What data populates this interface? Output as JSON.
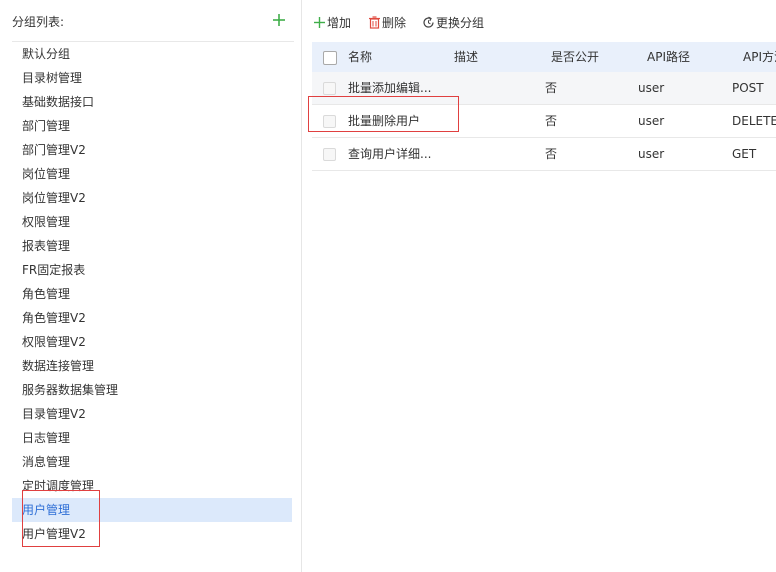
{
  "left_panel": {
    "title": "分组列表:",
    "add_icon": "plus-icon",
    "groups": [
      {
        "label": "默认分组"
      },
      {
        "label": "目录树管理"
      },
      {
        "label": "基础数据接口"
      },
      {
        "label": "部门管理"
      },
      {
        "label": "部门管理V2"
      },
      {
        "label": "岗位管理"
      },
      {
        "label": "岗位管理V2"
      },
      {
        "label": "权限管理"
      },
      {
        "label": "报表管理"
      },
      {
        "label": "FR固定报表"
      },
      {
        "label": "角色管理"
      },
      {
        "label": "角色管理V2"
      },
      {
        "label": "权限管理V2"
      },
      {
        "label": "数据连接管理"
      },
      {
        "label": "服务器数据集管理"
      },
      {
        "label": "目录管理V2"
      },
      {
        "label": "日志管理"
      },
      {
        "label": "消息管理"
      },
      {
        "label": "定时调度管理"
      },
      {
        "label": "用户管理"
      },
      {
        "label": "用户管理V2"
      }
    ],
    "selected_group": "用户管理"
  },
  "toolbar": {
    "add_label": "增加",
    "delete_label": "删除",
    "move_label": "更换分组",
    "add_icon": "plus-icon",
    "delete_icon": "trash-icon",
    "move_icon": "refresh-icon"
  },
  "table": {
    "columns": {
      "name": "名称",
      "desc": "描述",
      "public": "是否公开",
      "path": "API路径",
      "method": "API方法"
    },
    "rows": [
      {
        "name": "批量添加编辑...",
        "desc": "",
        "public": "否",
        "path": "user",
        "method": "POST"
      },
      {
        "name": "批量删除用户",
        "desc": "",
        "public": "否",
        "path": "user",
        "method": "DELETE"
      },
      {
        "name": "查询用户详细...",
        "desc": "",
        "public": "否",
        "path": "user",
        "method": "GET"
      }
    ]
  },
  "colors": {
    "accent_green": "#3fae49",
    "delete_red": "#e04a3f",
    "selected_bg": "#dce9fb",
    "header_bg": "#e9f0fb",
    "annotation_red": "#e04040"
  }
}
